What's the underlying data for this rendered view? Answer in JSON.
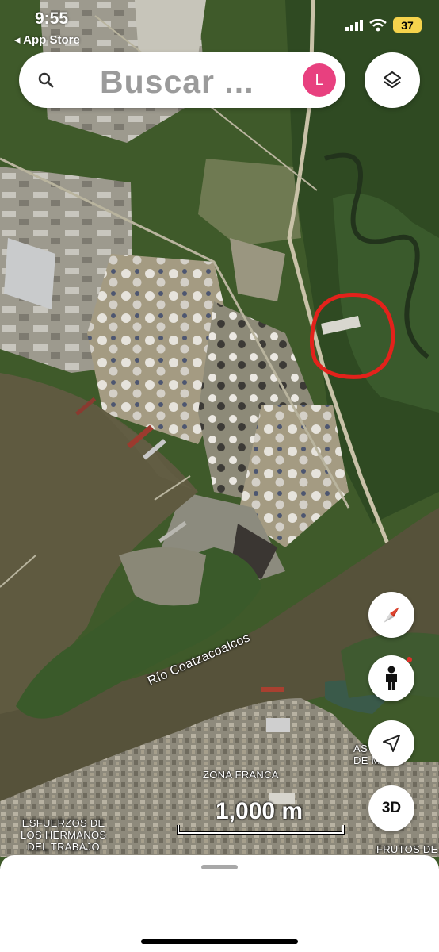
{
  "status_bar": {
    "time": "9:55",
    "back_app": "◂ App Store",
    "battery": "37"
  },
  "search": {
    "placeholder": "Buscar ...",
    "avatar_letter": "L",
    "avatar_color": "#e8407f"
  },
  "map": {
    "river_label": "Río Coatzacoalcos",
    "zone_label": "ZONA FRANCA",
    "place_labels": {
      "esfuerzos_1": "ESFUERZOS DE",
      "esfuerzos_2": "LOS HERMANOS",
      "esfuerzos_3": "DEL TRABAJO",
      "astilleros_1": "ASTI",
      "astilleros_2": "DE MA",
      "frutos": "FRUTOS DE"
    },
    "scale_label": "1,000 m",
    "annotation_color": "#e3221b"
  },
  "controls": {
    "threed_label": "3D",
    "icons": [
      "layers-icon",
      "compass-icon",
      "street-view-icon",
      "navigation-arrow-icon"
    ]
  }
}
